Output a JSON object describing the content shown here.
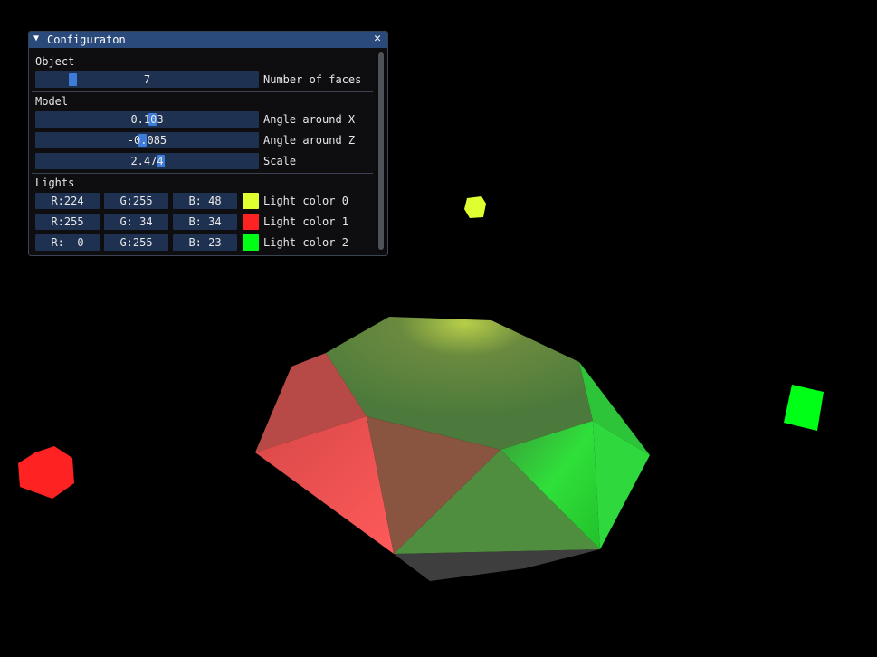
{
  "window": {
    "title": "Configuraton",
    "collapse_icon": "triangle-down-icon",
    "close_icon": "close-icon"
  },
  "object": {
    "header": "Object",
    "faces": {
      "value": "7",
      "label": "Number of faces",
      "fraction": 0.17
    }
  },
  "model": {
    "header": "Model",
    "angle_x": {
      "value": "0.103",
      "label": "Angle around X",
      "fraction": 0.52
    },
    "angle_z": {
      "value": "-0.085",
      "label": "Angle around Z",
      "fraction": 0.48
    },
    "scale": {
      "value": "2.474",
      "label": "Scale",
      "fraction": 0.56
    }
  },
  "lights": {
    "header": "Lights",
    "items": [
      {
        "r": "R:224",
        "g": "G:255",
        "b": "B: 48",
        "label": "Light color 0",
        "color": "#e0ff30"
      },
      {
        "r": "R:255",
        "g": "G: 34",
        "b": "B: 34",
        "label": "Light color 1",
        "color": "#ff2222"
      },
      {
        "r": "R:  0",
        "g": "G:255",
        "b": "B: 23",
        "label": "Light color 2",
        "color": "#00ff17"
      }
    ]
  },
  "colors": {
    "accent": "#3d7cd9",
    "titlebar": "#294a7a",
    "frame_bg": "#1f3150"
  }
}
